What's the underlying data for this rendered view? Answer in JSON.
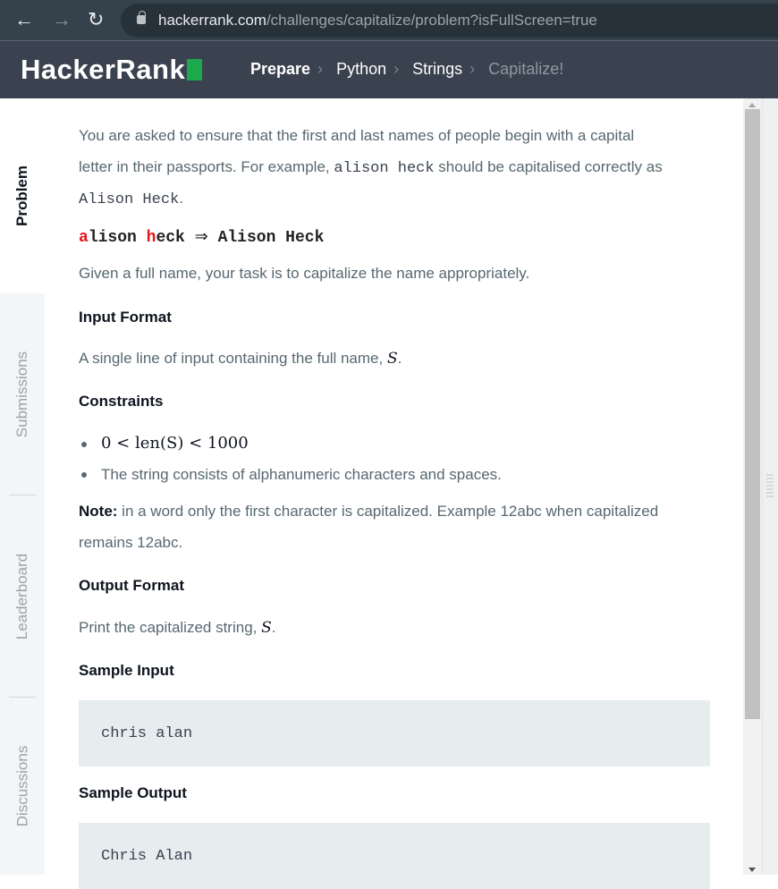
{
  "browser": {
    "url_host": "hackerrank.com",
    "url_path": "/challenges/capitalize/problem?isFullScreen=true",
    "back_icon": "arrow-left",
    "forward_icon": "arrow-right",
    "reload_icon": "reload",
    "lock_icon": "lock"
  },
  "header": {
    "logo": "HackerRank",
    "breadcrumb": [
      "Prepare",
      "Python",
      "Strings",
      "Capitalize!"
    ]
  },
  "sidebar": {
    "tabs": [
      {
        "label": "Problem",
        "active": true
      },
      {
        "label": "Submissions"
      },
      {
        "label": "Leaderboard"
      },
      {
        "label": "Discussions"
      }
    ]
  },
  "problem": {
    "intro_1": "You are asked to ensure that the first and last names of people begin with a capital",
    "intro_2a": "letter in their passports. For example, ",
    "intro_2_code": "alison heck",
    "intro_2b": " should be capitalised correctly as",
    "intro_3_code": "Alison Heck",
    "intro_3b": ".",
    "example": {
      "a": "a",
      "lison": "lison ",
      "h": "h",
      "eck": "eck",
      "arrow": "⇒",
      "result": "Alison Heck"
    },
    "task": "Given a full name, your task is to capitalize the name appropriately.",
    "input_heading": "Input Format",
    "input_text": "A single line of input containing the full name, ",
    "input_var": "S",
    "period": ".",
    "constraints_heading": "Constraints",
    "constraint_1": "0 < len(S) < 1000",
    "constraint_2": "The string consists of alphanumeric characters and spaces.",
    "note_label": "Note:",
    "note_1": " in a word only the first character is capitalized. Example 12abc when capitalized",
    "note_2": "remains 12abc.",
    "output_heading": "Output Format",
    "output_text": "Print the capitalized string, ",
    "output_var": "S",
    "sample_input_heading": "Sample Input",
    "sample_input": "chris alan",
    "sample_output_heading": "Sample Output",
    "sample_output": "Chris Alan"
  }
}
